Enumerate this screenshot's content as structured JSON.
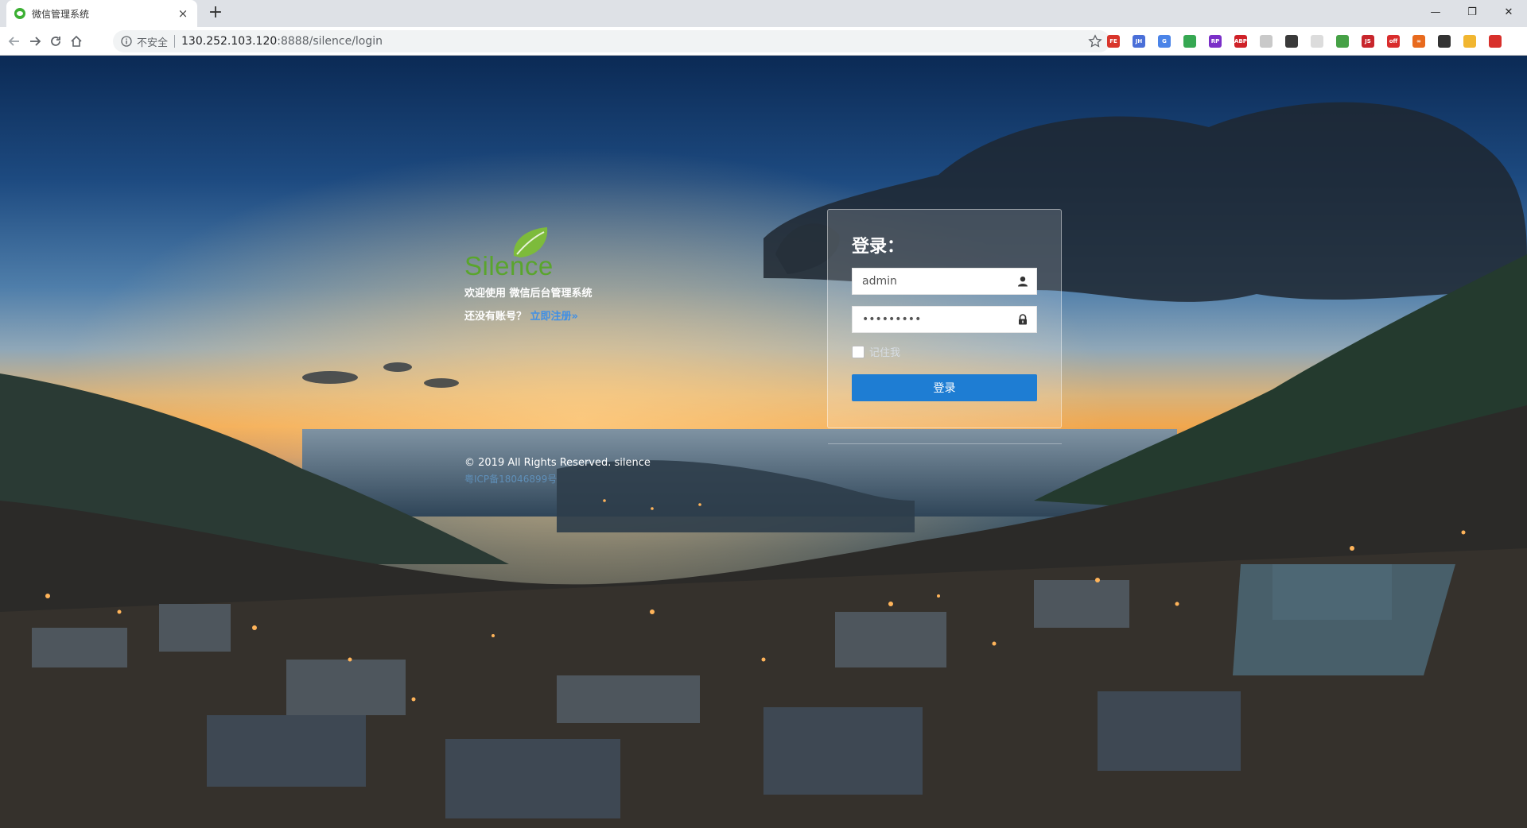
{
  "browser": {
    "tab": {
      "title": "微信管理系统",
      "close": "×"
    },
    "new_tab": "+",
    "window": {
      "minimize": "—",
      "restore": "❐",
      "close": "✕"
    },
    "address": {
      "security_label": "不安全",
      "host": "130.252.103.120",
      "path": ":8888/silence/login"
    },
    "extensions": [
      {
        "name": "fe-helper-icon",
        "label": "FE",
        "color": "#d9352b"
      },
      {
        "name": "jh-icon",
        "label": "JH",
        "color": "#4a6fd8"
      },
      {
        "name": "translate-icon",
        "label": "G",
        "color": "#4b84e8"
      },
      {
        "name": "chrome-ext-icon",
        "label": "",
        "color": "#36a852"
      },
      {
        "name": "rp-icon",
        "label": "RP",
        "color": "#7b2fc8"
      },
      {
        "name": "adblock-icon",
        "label": "ABP",
        "color": "#cf2128"
      },
      {
        "name": "ext-gray-icon",
        "label": "",
        "color": "#c9c9c9"
      },
      {
        "name": "tool-icon",
        "label": "",
        "color": "#3a3a3a"
      },
      {
        "name": "ext-light-icon",
        "label": "",
        "color": "#dcdcdc"
      },
      {
        "name": "download-icon",
        "label": "",
        "color": "#46a146"
      },
      {
        "name": "js-icon",
        "label": "JS",
        "color": "#c8262c"
      },
      {
        "name": "off-icon",
        "label": "off",
        "color": "#d92d2d"
      },
      {
        "name": "link-icon",
        "label": "∞",
        "color": "#e86a1e"
      },
      {
        "name": "sync-icon",
        "label": "",
        "color": "#333333"
      },
      {
        "name": "emoji-icon",
        "label": "",
        "color": "#f1b630"
      },
      {
        "name": "update-icon",
        "label": "",
        "color": "#d8302b"
      }
    ]
  },
  "brand": {
    "logo_text": "Silence",
    "welcome": "欢迎使用 微信后台管理系统",
    "register_prompt": "还没有账号？",
    "register_link": "立即注册»"
  },
  "login": {
    "title": "登录：",
    "username_value": "admin",
    "password_value": "•••••••••",
    "remember_label": "记住我",
    "submit_label": "登录"
  },
  "footer": {
    "copyright": "© 2019 All Rights Reserved. silence",
    "icp": "粤ICP备18046899号"
  },
  "colors": {
    "accent": "#1e7dd3",
    "logo_green": "#5aa52d",
    "link": "#3f8fe6"
  }
}
